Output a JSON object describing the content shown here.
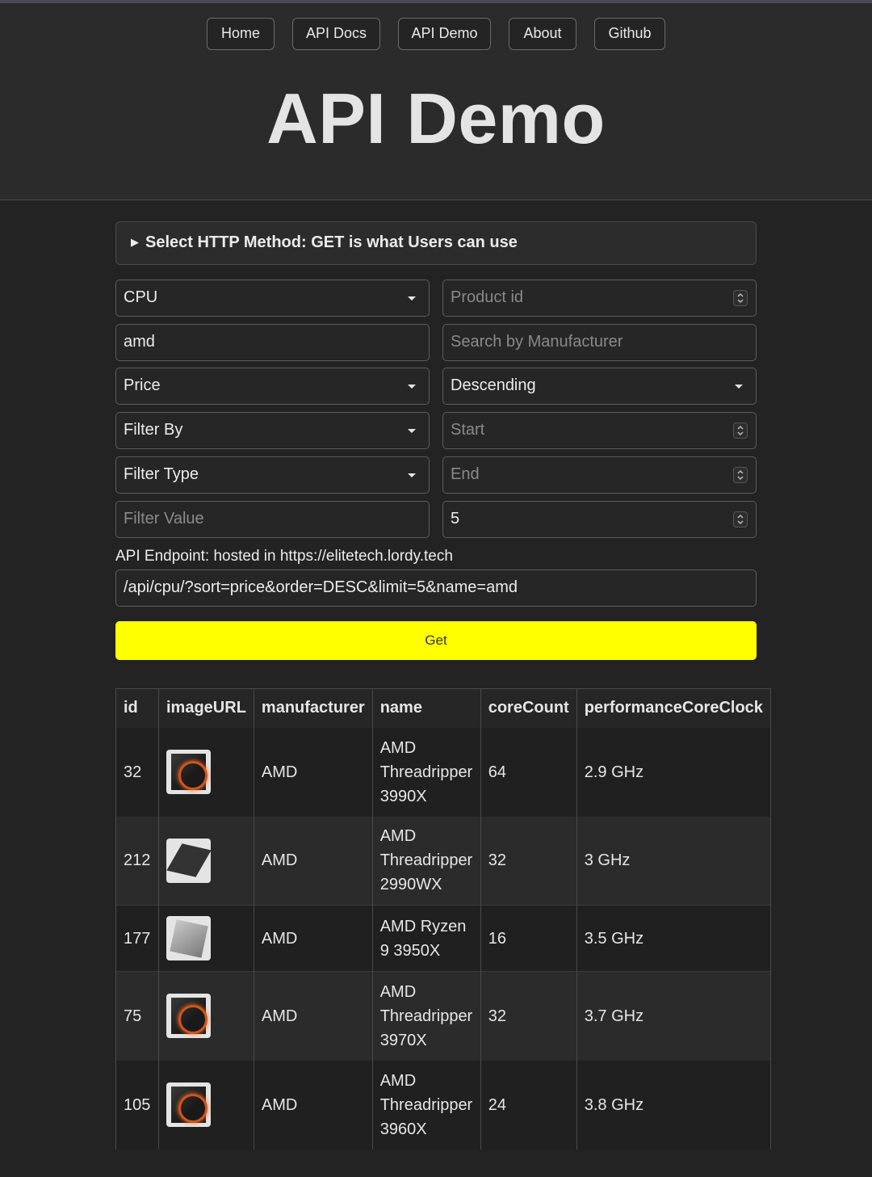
{
  "nav": [
    "Home",
    "API Docs",
    "API Demo",
    "About",
    "Github"
  ],
  "page_title": "API Demo",
  "method_summary": "Select HTTP Method: GET is what Users can use",
  "form": {
    "category": "CPU",
    "product_id_placeholder": "Product id",
    "name_value": "amd",
    "manufacturer_placeholder": "Search by Manufacturer",
    "sort": "Price",
    "order": "Descending",
    "filter_by": "Filter By",
    "start_placeholder": "Start",
    "filter_type": "Filter Type",
    "end_placeholder": "End",
    "filter_value_placeholder": "Filter Value",
    "limit": "5"
  },
  "endpoint": {
    "label": "API Endpoint: hosted in https://elitetech.lordy.tech",
    "value": "/api/cpu/?sort=price&order=DESC&limit=5&name=amd"
  },
  "get_label": "Get",
  "table": {
    "headers": [
      "id",
      "imageURL",
      "manufacturer",
      "name",
      "coreCount",
      "performanceCoreClock"
    ],
    "rows": [
      {
        "id": "32",
        "image": "cpu-box-icon",
        "manufacturer": "AMD",
        "name_lines": [
          "AMD",
          "Threadripper",
          "3990X"
        ],
        "coreCount": "64",
        "clock": "2.9 GHz"
      },
      {
        "id": "212",
        "image": "cpu-chip-icon",
        "manufacturer": "AMD",
        "name_lines": [
          "AMD",
          "Threadripper",
          "2990WX"
        ],
        "coreCount": "32",
        "clock": "3 GHz"
      },
      {
        "id": "177",
        "image": "cpu-chip-icon",
        "manufacturer": "AMD",
        "name_lines": [
          "AMD Ryzen",
          "9 3950X"
        ],
        "coreCount": "16",
        "clock": "3.5 GHz"
      },
      {
        "id": "75",
        "image": "cpu-box-icon",
        "manufacturer": "AMD",
        "name_lines": [
          "AMD",
          "Threadripper",
          "3970X"
        ],
        "coreCount": "32",
        "clock": "3.7 GHz"
      },
      {
        "id": "105",
        "image": "cpu-box-icon",
        "manufacturer": "AMD",
        "name_lines": [
          "AMD",
          "Threadripper",
          "3960X"
        ],
        "coreCount": "24",
        "clock": "3.8 GHz"
      }
    ]
  },
  "colors": {
    "background": "#232323",
    "header": "#2b2b2b",
    "get_button": "#ffff00"
  }
}
